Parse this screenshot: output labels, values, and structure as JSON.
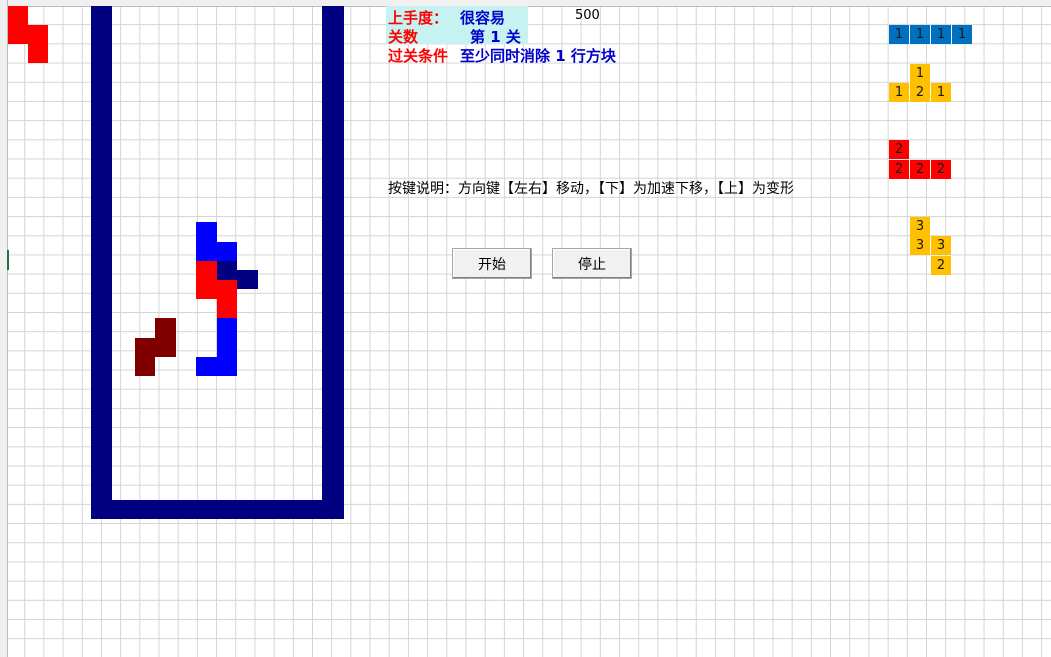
{
  "header": {
    "difficulty_label": "上手度：",
    "difficulty_value": "很容易",
    "score": "500",
    "level_label": "关数",
    "level_value": "第 1 关",
    "goal_label": "过关条件",
    "goal_value": "至少同时消除 1 行方块"
  },
  "instructions": "按键说明：方向键【左右】移动，【下】为加速下移，【上】为变形",
  "buttons": {
    "start": "开始",
    "stop": "停止"
  },
  "colors": {
    "wall": "#000080",
    "red": "#ff0000",
    "blue": "#0000ff",
    "darkred": "#800000",
    "preview_blue": "#0070c0",
    "preview_yellow": "#ffc000",
    "preview_red": "#ff0000",
    "info_bg": "#c6f2f2",
    "label_red": "#ff0000",
    "value_blue": "#0000cc"
  },
  "board": {
    "columns": 10,
    "rows": 20,
    "falling_piece": {
      "shape": "T",
      "color": "wall",
      "cells": [
        [
          6,
          13
        ],
        [
          5,
          14
        ],
        [
          6,
          14
        ],
        [
          7,
          14
        ]
      ]
    },
    "locked_cells": [
      {
        "col": 5,
        "row": 17,
        "color": "blue"
      },
      {
        "col": 5,
        "row": 18,
        "color": "blue"
      },
      {
        "col": 6,
        "row": 18,
        "color": "blue"
      },
      {
        "col": 5,
        "row": 19,
        "color": "red"
      },
      {
        "col": 5,
        "row": 20,
        "color": "red"
      },
      {
        "col": 6,
        "row": 20,
        "color": "red"
      },
      {
        "col": 6,
        "row": 21,
        "color": "red"
      },
      {
        "col": 6,
        "row": 22,
        "color": "blue"
      },
      {
        "col": 6,
        "row": 23,
        "color": "blue"
      },
      {
        "col": 5,
        "row": 24,
        "color": "blue"
      },
      {
        "col": 6,
        "row": 24,
        "color": "blue"
      },
      {
        "col": 3,
        "row": 22,
        "color": "darkred"
      },
      {
        "col": 2,
        "row": 23,
        "color": "darkred"
      },
      {
        "col": 3,
        "row": 23,
        "color": "darkred"
      },
      {
        "col": 2,
        "row": 24,
        "color": "darkred"
      }
    ]
  },
  "corner_piece": {
    "color": "red",
    "cells": [
      [
        0,
        0
      ],
      [
        0,
        1
      ],
      [
        1,
        1
      ],
      [
        1,
        2
      ]
    ]
  },
  "previews": [
    {
      "name": "I",
      "color": "preview_blue",
      "cells": [
        [
          0,
          1,
          "1"
        ],
        [
          1,
          1,
          "1"
        ],
        [
          2,
          1,
          "1"
        ],
        [
          3,
          1,
          "1"
        ]
      ]
    },
    {
      "name": "T",
      "color": "preview_yellow",
      "cells": [
        [
          1,
          3,
          "1"
        ],
        [
          0,
          4,
          "1"
        ],
        [
          1,
          4,
          "2"
        ],
        [
          2,
          4,
          "1"
        ]
      ]
    },
    {
      "name": "J",
      "color": "preview_red",
      "cells": [
        [
          0,
          7,
          "2"
        ],
        [
          0,
          8,
          "2"
        ],
        [
          1,
          8,
          "2"
        ],
        [
          2,
          8,
          "2"
        ]
      ]
    },
    {
      "name": "S",
      "color": "preview_yellow",
      "cells": [
        [
          1,
          11,
          "3"
        ],
        [
          1,
          12,
          "3"
        ],
        [
          2,
          12,
          "3"
        ],
        [
          2,
          13,
          "2"
        ]
      ]
    }
  ]
}
